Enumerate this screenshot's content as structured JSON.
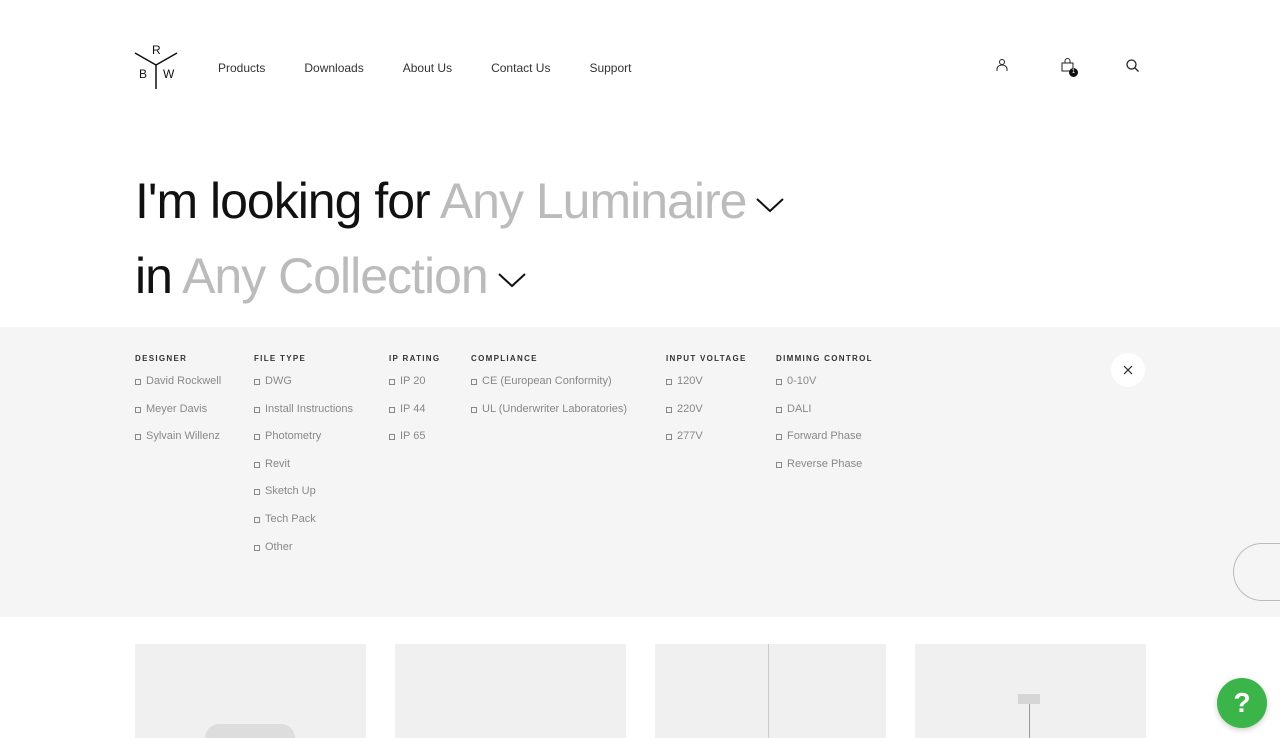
{
  "logo": {
    "letters": [
      "R",
      "B",
      "W"
    ]
  },
  "nav": [
    "Products",
    "Downloads",
    "About Us",
    "Contact Us",
    "Support"
  ],
  "cart_count": "1",
  "headline": {
    "line1_prefix": "I'm looking for",
    "line1_select": "Any Luminaire",
    "line2_prefix": "in",
    "line2_select": "Any Collection"
  },
  "filters": [
    {
      "title": "DESIGNER",
      "options": [
        "David Rockwell",
        "Meyer Davis",
        "Sylvain Willenz"
      ]
    },
    {
      "title": "FILE TYPE",
      "options": [
        "DWG",
        "Install Instructions",
        "Photometry",
        "Revit",
        "Sketch Up",
        "Tech Pack",
        "Other"
      ]
    },
    {
      "title": "IP RATING",
      "options": [
        "IP 20",
        "IP 44",
        "IP 65"
      ]
    },
    {
      "title": "COMPLIANCE",
      "options": [
        "CE (European Conformity)",
        "UL (Underwriter Laboratories)"
      ]
    },
    {
      "title": "INPUT VOLTAGE",
      "options": [
        "120V",
        "220V",
        "277V"
      ]
    },
    {
      "title": "DIMMING CONTROL",
      "options": [
        "0-10V",
        "DALI",
        "Forward Phase",
        "Reverse Phase"
      ]
    }
  ],
  "help_label": "?",
  "colors": {
    "panel": "#f5f5f5",
    "help": "#3bb54a",
    "muted": "#bbbbbb"
  }
}
